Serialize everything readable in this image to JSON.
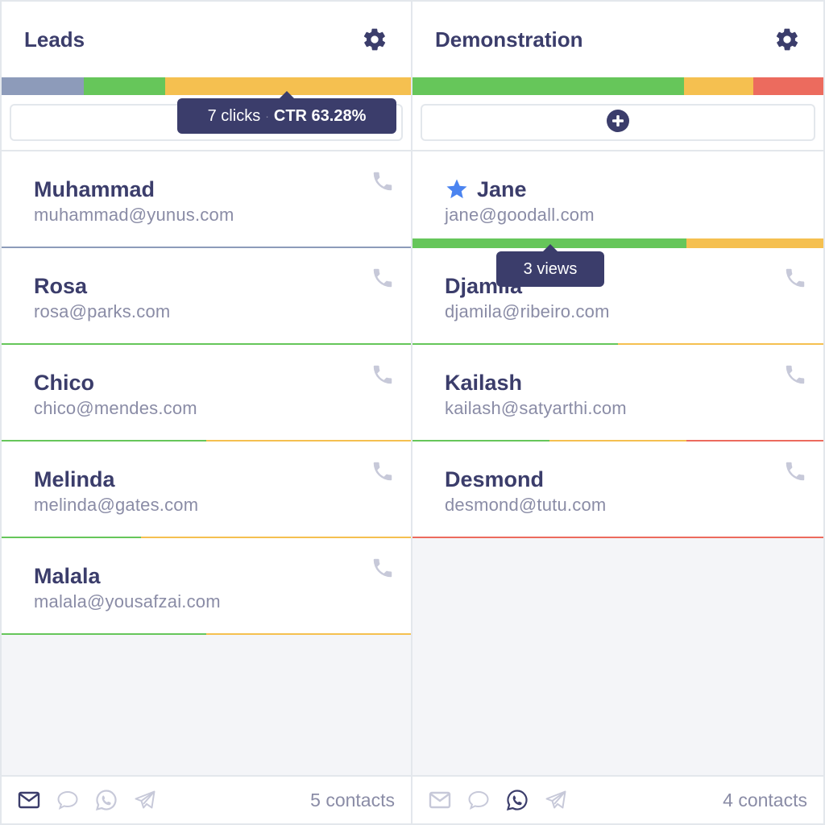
{
  "colors": {
    "gray": "#8d9bba",
    "green": "#66c65a",
    "yellow": "#f5c050",
    "red": "#ec6b5e",
    "text": "#3b3d6b",
    "muted": "#8a8ca6",
    "star": "#4b84f0"
  },
  "columns": [
    {
      "title": "Leads",
      "settings_icon": "gear-icon",
      "stage_bar": [
        {
          "color": "gray",
          "fraction": 0.2
        },
        {
          "color": "green",
          "fraction": 0.2
        },
        {
          "color": "yellow",
          "fraction": 0.6
        }
      ],
      "tooltip": {
        "clicks": "7 clicks",
        "sep": "·",
        "ctr": "CTR 63.28%"
      },
      "cards": [
        {
          "name": "Muhammad",
          "email": "muhammad@yunus.com",
          "starred": false,
          "bar": [
            {
              "color": "gray",
              "fraction": 1.0
            }
          ]
        },
        {
          "name": "Rosa",
          "email": "rosa@parks.com",
          "starred": false,
          "bar": [
            {
              "color": "green",
              "fraction": 1.0
            }
          ]
        },
        {
          "name": "Chico",
          "email": "chico@mendes.com",
          "starred": false,
          "bar": [
            {
              "color": "green",
              "fraction": 0.5
            },
            {
              "color": "yellow",
              "fraction": 0.5
            }
          ]
        },
        {
          "name": "Melinda",
          "email": "melinda@gates.com",
          "starred": false,
          "bar": [
            {
              "color": "green",
              "fraction": 0.34
            },
            {
              "color": "yellow",
              "fraction": 0.66
            }
          ]
        },
        {
          "name": "Malala",
          "email": "malala@yousafzai.com",
          "starred": false,
          "bar": [
            {
              "color": "green",
              "fraction": 0.5
            },
            {
              "color": "yellow",
              "fraction": 0.5
            }
          ]
        }
      ],
      "footer": {
        "active_channel": "email",
        "count": "5 contacts"
      }
    },
    {
      "title": "Demonstration",
      "settings_icon": "gear-icon",
      "stage_bar": [
        {
          "color": "green",
          "fraction": 0.66
        },
        {
          "color": "yellow",
          "fraction": 0.17
        },
        {
          "color": "red",
          "fraction": 0.17
        }
      ],
      "tooltip": {
        "views": "3 views"
      },
      "cards": [
        {
          "name": "Jane",
          "email": "jane@goodall.com",
          "starred": true,
          "bar": [
            {
              "color": "green",
              "fraction": 0.666
            },
            {
              "color": "yellow",
              "fraction": 0.334
            }
          ]
        },
        {
          "name": "Djamila",
          "email": "djamila@ribeiro.com",
          "starred": false,
          "bar": [
            {
              "color": "green",
              "fraction": 0.5
            },
            {
              "color": "yellow",
              "fraction": 0.5
            }
          ]
        },
        {
          "name": "Kailash",
          "email": "kailash@satyarthi.com",
          "starred": false,
          "bar": [
            {
              "color": "green",
              "fraction": 0.333
            },
            {
              "color": "yellow",
              "fraction": 0.333
            },
            {
              "color": "red",
              "fraction": 0.334
            }
          ]
        },
        {
          "name": "Desmond",
          "email": "desmond@tutu.com",
          "starred": false,
          "bar": [
            {
              "color": "red",
              "fraction": 1.0
            }
          ]
        }
      ],
      "footer": {
        "active_channel": "whatsapp",
        "count": "4 contacts"
      }
    }
  ]
}
